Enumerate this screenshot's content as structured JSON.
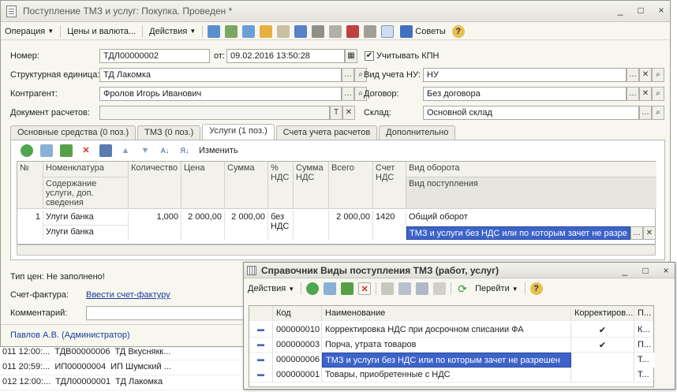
{
  "window": {
    "title": "Поступление ТМЗ и услуг: Покупка. Проведен *",
    "controls": [
      "_",
      "□",
      "×"
    ]
  },
  "toolbar": {
    "operation": "Операция",
    "prices": "Цены и валюта...",
    "actions": "Действия",
    "advice": "Советы",
    "help": "?"
  },
  "form": {
    "number_label": "Номер:",
    "number_value": "ТДЛ00000002",
    "date_label": "от:",
    "date_value": "09.02.2016 13:50:28",
    "vat_checkbox_label": "Учитывать КПН",
    "vat_checked": true,
    "unit_label": "Структурная единица:",
    "unit_value": "ТД Лакомка",
    "tax_label": "Вид учета НУ:",
    "tax_value": "НУ",
    "counterparty_label": "Контрагент:",
    "counterparty_value": "Фролов Игорь Иванович",
    "contract_label": "Договор:",
    "contract_value": "Без договора",
    "settlement_label": "Документ расчетов:",
    "settlement_value": "",
    "warehouse_label": "Склад:",
    "warehouse_value": "Основной склад"
  },
  "tabs": [
    "Основные средства (0 поз.)",
    "ТМЗ (0 поз.)",
    "Услуги (1 поз.)",
    "Счета учета расчетов",
    "Дополнительно"
  ],
  "tabs_active": 2,
  "table_toolbar": {
    "edit": "Изменить"
  },
  "table": {
    "headers": {
      "num": "№",
      "nom": "Номенклатура",
      "nom2": "Содержание услуги, доп. сведения",
      "qty": "Количество",
      "price": "Цена",
      "sum": "Сумма",
      "vat_pct": "% НДС",
      "vat_sum": "Сумма НДС",
      "total": "Всего",
      "account": "Счет НДС",
      "turnover": "Вид оборота",
      "receipt": "Вид поступления"
    },
    "row": {
      "num": "1",
      "nom": "Улуги банка",
      "nom2": "Улуги банка",
      "qty": "1,000",
      "price": "2 000,00",
      "sum": "2 000,00",
      "vat_pct": "без НДС",
      "vat_sum": "",
      "total": "2 000,00",
      "account": "1420",
      "turnover": "Общий оборот",
      "receipt": "ТМЗ и услуги без НДС или по которым зачет не разре"
    }
  },
  "footer": {
    "price_type": "Тип цен: Не заполнено!",
    "invoice_label": "Счет-фактура:",
    "invoice_link": "Ввести счет-фактуру",
    "comment_label": "Комментарий:",
    "user": "Павлов А.В. (Администратор)"
  },
  "background_rows": [
    [
      "011 12:00:...",
      "ТДВ00000006",
      "ТД Вкуснякк..."
    ],
    [
      "011 20:59:...",
      "ИП00000004",
      "ИП Шумский ..."
    ],
    [
      "012 12:00:...",
      "ТДЛ00000001",
      "ТД Лакомка"
    ]
  ],
  "dialog": {
    "title": "Справочник  Виды поступления ТМЗ (работ, услуг)",
    "actions": "Действия",
    "goto": "Перейти",
    "help": "?",
    "headers": {
      "code": "Код",
      "name": "Наименование",
      "corr": "Корректиров...",
      "p": "П..."
    },
    "rows": [
      {
        "code": "000000010",
        "name": "Корректировка НДС при досрочном списании ФА",
        "corr": "✔",
        "p": "К..."
      },
      {
        "code": "000000003",
        "name": "Порча, утрата товаров",
        "corr": "✔",
        "p": "П..."
      },
      {
        "code": "000000006",
        "name": "ТМЗ и услуги без НДС или по которым зачет не разрешен",
        "corr": "",
        "p": "Т..."
      },
      {
        "code": "000000001",
        "name": "Товары, приобретенные с НДС",
        "corr": "",
        "p": "Т..."
      }
    ],
    "selected_row": 2
  },
  "colors": {
    "selection": "#3d63c9",
    "link": "#1a3c9a",
    "window_bg": "#f7f7ef"
  }
}
